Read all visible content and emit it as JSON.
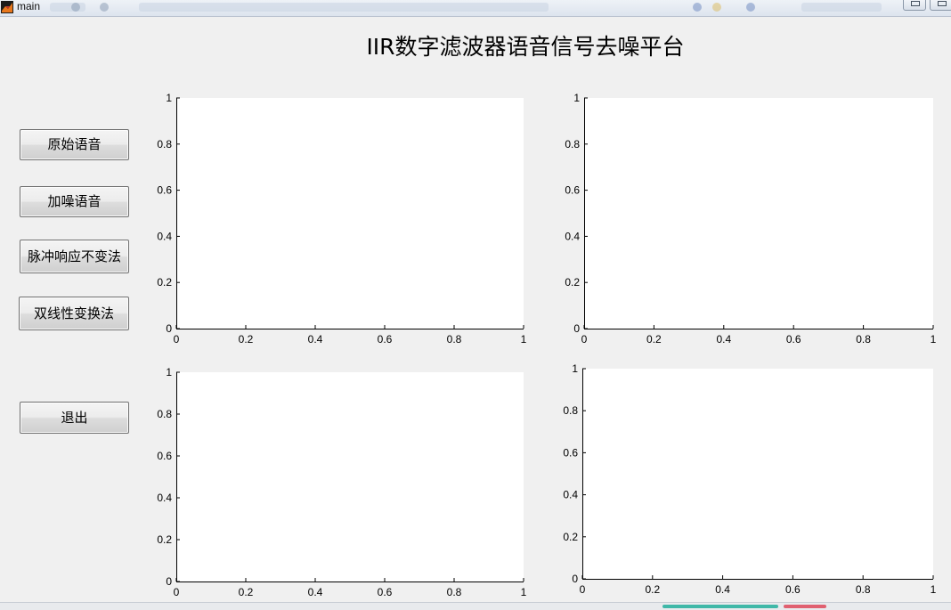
{
  "window": {
    "title": "main"
  },
  "page": {
    "title": "IIR数字滤波器语音信号去噪平台"
  },
  "buttons": [
    {
      "label": "原始语音"
    },
    {
      "label": "加噪语音"
    },
    {
      "label": "脉冲响应不变法"
    },
    {
      "label": "双线性变换法"
    },
    {
      "label": "退出"
    }
  ],
  "chart_data": [
    {
      "type": "line",
      "title": "",
      "xlabel": "",
      "ylabel": "",
      "xlim": [
        0,
        1
      ],
      "ylim": [
        0,
        1
      ],
      "xticks": [
        "0",
        "0.2",
        "0.4",
        "0.6",
        "0.8",
        "1"
      ],
      "yticks": [
        "0",
        "0.2",
        "0.4",
        "0.6",
        "0.8",
        "1"
      ],
      "series": []
    },
    {
      "type": "line",
      "title": "",
      "xlabel": "",
      "ylabel": "",
      "xlim": [
        0,
        1
      ],
      "ylim": [
        0,
        1
      ],
      "xticks": [
        "0",
        "0.2",
        "0.4",
        "0.6",
        "0.8",
        "1"
      ],
      "yticks": [
        "0",
        "0.2",
        "0.4",
        "0.6",
        "0.8",
        "1"
      ],
      "series": []
    },
    {
      "type": "line",
      "title": "",
      "xlabel": "",
      "ylabel": "",
      "xlim": [
        0,
        1
      ],
      "ylim": [
        0,
        1
      ],
      "xticks": [
        "0",
        "0.2",
        "0.4",
        "0.6",
        "0.8",
        "1"
      ],
      "yticks": [
        "0",
        "0.2",
        "0.4",
        "0.6",
        "0.8",
        "1"
      ],
      "series": []
    },
    {
      "type": "line",
      "title": "",
      "xlabel": "",
      "ylabel": "",
      "xlim": [
        0,
        1
      ],
      "ylim": [
        0,
        1
      ],
      "xticks": [
        "0",
        "0.2",
        "0.4",
        "0.6",
        "0.8",
        "1"
      ],
      "yticks": [
        "0",
        "0.2",
        "0.4",
        "0.6",
        "0.8",
        "1"
      ],
      "series": []
    }
  ]
}
